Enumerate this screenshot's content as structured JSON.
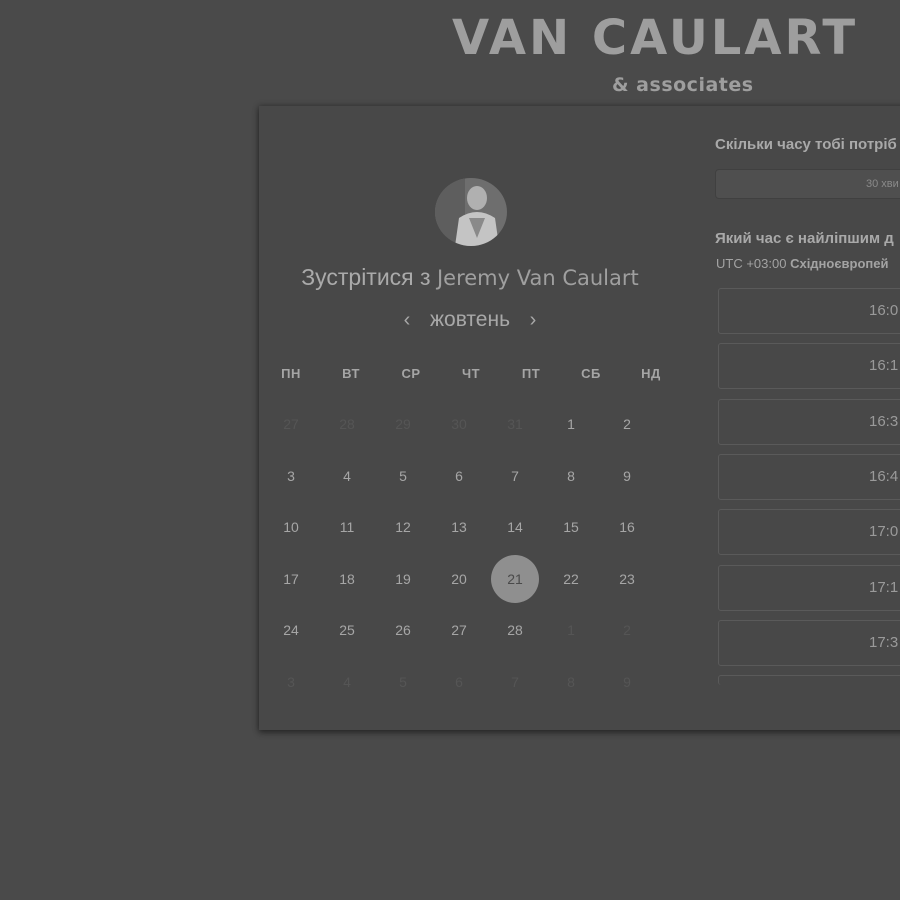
{
  "brand": {
    "name": "VAN CAULART",
    "sub": "& associates"
  },
  "meeting": {
    "prefix": "Зустрітися з",
    "host": "Jeremy Van Caulart"
  },
  "calendar": {
    "month": "жовтень",
    "prev_icon": "‹",
    "next_icon": "›",
    "weekdays": [
      "ПН",
      "ВТ",
      "СР",
      "ЧТ",
      "ПТ",
      "СБ",
      "НД"
    ],
    "weeks": [
      [
        "27",
        "28",
        "29",
        "30",
        "31",
        "1",
        "2"
      ],
      [
        "3",
        "4",
        "5",
        "6",
        "7",
        "8",
        "9"
      ],
      [
        "10",
        "11",
        "12",
        "13",
        "14",
        "15",
        "16"
      ],
      [
        "17",
        "18",
        "19",
        "20",
        "21",
        "22",
        "23"
      ],
      [
        "24",
        "25",
        "26",
        "27",
        "28",
        "1",
        "2"
      ],
      [
        "3",
        "4",
        "5",
        "6",
        "7",
        "8",
        "9"
      ]
    ],
    "selected": "21"
  },
  "booking": {
    "duration_question": "Скільки часу тобі потріб",
    "duration_value": "30 хви",
    "time_question": "Який час є найліпшим д",
    "tz_offset": "UTC +03:00",
    "tz_name": "Східноєвропей",
    "slots": [
      "16:0",
      "16:1",
      "16:3",
      "16:4",
      "17:0",
      "17:1",
      "17:3"
    ]
  },
  "colors": {
    "background": "#4a4a4a",
    "card": "#484848",
    "selected_day": "#8f8f8f"
  },
  "icons": {
    "avatar": "person-avatar-icon"
  }
}
